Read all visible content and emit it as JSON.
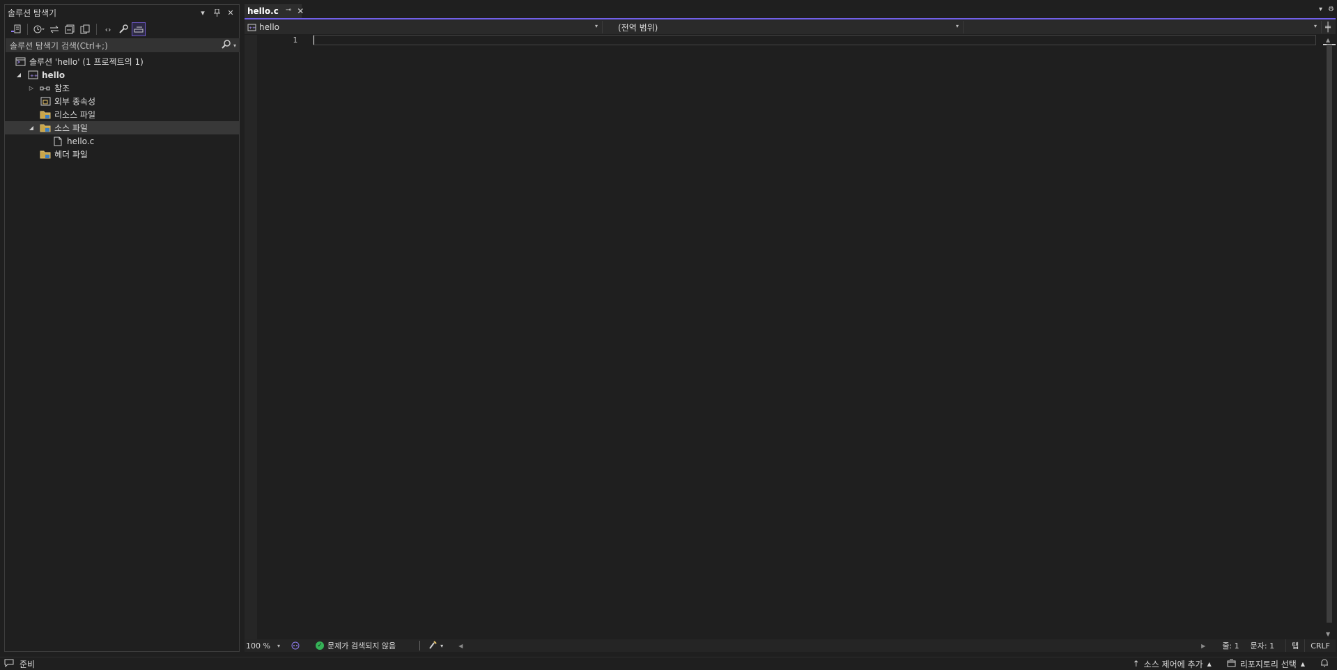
{
  "solution_explorer": {
    "title": "솔루션 탐색기",
    "search_placeholder": "솔루션 탐색기 검색(Ctrl+;)",
    "tree": {
      "solution": "솔루션 'hello' (1 프로젝트의 1)",
      "project": "hello",
      "references": "참조",
      "external_deps": "외부 종속성",
      "resource_files": "리소스 파일",
      "source_files": "소스 파일",
      "source_file_item": "hello.c",
      "header_files": "헤더 파일"
    }
  },
  "editor": {
    "tab_label": "hello.c",
    "nav_project": "hello",
    "nav_scope": "(전역 범위)",
    "nav_member": "",
    "line_numbers": "1",
    "zoom": "100 %",
    "issues_text": "문제가 검색되지 않음",
    "line_pos": "줄: 1",
    "char_pos": "문자: 1",
    "indent_mode": "탭",
    "line_ending": "CRLF"
  },
  "status_bar": {
    "ready": "준비",
    "add_source_control": "소스 제어에 추가",
    "select_repo": "리포지토리 선택"
  },
  "colors": {
    "accent": "#7160e8",
    "background": "#1f1f1f",
    "issues_ok": "#35b257"
  }
}
